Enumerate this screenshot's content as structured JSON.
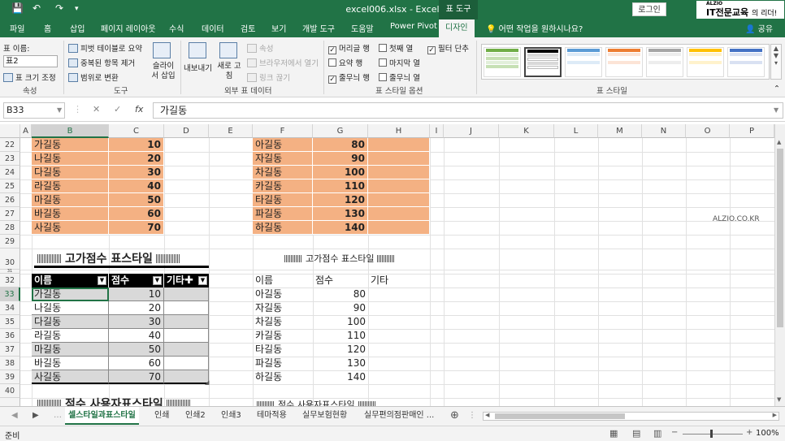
{
  "titlebar": {
    "title": "excel006.xlsx - Excel",
    "context_tab": "표 도구",
    "login": "로그인",
    "logo_top": "ALZIO",
    "logo_main": "IT전문교육",
    "logo_sub": "의 리더!"
  },
  "ribbon_tabs": [
    "파일",
    "홈",
    "삽입",
    "페이지 레이아웃",
    "수식",
    "데이터",
    "검토",
    "보기",
    "개발 도구",
    "도움말",
    "Power Pivot",
    "디자인"
  ],
  "tell_me": "어떤 작업을 원하시나요?",
  "share": "공유",
  "ribbon": {
    "props_label": "표 이름:",
    "table_name": "표2",
    "resize": "표 크기 조정",
    "props_group": "속성",
    "pivot": "피벗 테이블로 요약",
    "remove_dup": "중복된 항목 제거",
    "convert_range": "범위로 변환",
    "slicer": "슬라이서 삽입",
    "tools_group": "도구",
    "export": "내보내기",
    "refresh": "새로 고침",
    "properties": "속성",
    "open_browser": "브라우저에서 열기",
    "unlink": "링크 끊기",
    "external_group": "외부 표 데이터",
    "opt_header": "머리글 행",
    "opt_total": "요약 행",
    "opt_banded_rows": "줄무늬 행",
    "opt_first_col": "첫째 열",
    "opt_last_col": "마지막 열",
    "opt_banded_cols": "줄무늬 열",
    "opt_filter": "필터 단추",
    "options_group": "표 스타일 옵션",
    "styles_group": "표 스타일"
  },
  "formula_bar": {
    "name_box": "B33",
    "cancel": "✕",
    "enter": "✓",
    "fx": "fx",
    "formula": "가길동"
  },
  "columns": [
    "A",
    "B",
    "C",
    "D",
    "E",
    "F",
    "G",
    "H",
    "I",
    "J",
    "K",
    "L",
    "M",
    "N",
    "O",
    "P"
  ],
  "rows": [
    "22",
    "23",
    "24",
    "25",
    "26",
    "27",
    "28",
    "29",
    "30",
    "31",
    "32",
    "33",
    "34",
    "35",
    "36",
    "37",
    "38",
    "39",
    "40",
    "41"
  ],
  "orange_left": [
    {
      "name": "가길동",
      "score": "10"
    },
    {
      "name": "나길동",
      "score": "20"
    },
    {
      "name": "다길동",
      "score": "30"
    },
    {
      "name": "라길동",
      "score": "40"
    },
    {
      "name": "마길동",
      "score": "50"
    },
    {
      "name": "바길동",
      "score": "60"
    },
    {
      "name": "사길동",
      "score": "70"
    }
  ],
  "orange_right": [
    {
      "name": "아길동",
      "score": "80"
    },
    {
      "name": "자길동",
      "score": "90"
    },
    {
      "name": "차길동",
      "score": "100"
    },
    {
      "name": "카길동",
      "score": "110"
    },
    {
      "name": "타길동",
      "score": "120"
    },
    {
      "name": "파길동",
      "score": "130"
    },
    {
      "name": "하길동",
      "score": "140"
    }
  ],
  "section1_title": "고가점수 표스타일",
  "section2_title": "점수 사용자표스타일",
  "table_headers": [
    "이름",
    "점수",
    "기타"
  ],
  "table_left": [
    {
      "name": "가길동",
      "score": "10"
    },
    {
      "name": "나길동",
      "score": "20"
    },
    {
      "name": "다길동",
      "score": "30"
    },
    {
      "name": "라길동",
      "score": "40"
    },
    {
      "name": "마길동",
      "score": "50"
    },
    {
      "name": "바길동",
      "score": "60"
    },
    {
      "name": "사길동",
      "score": "70"
    }
  ],
  "table_right": [
    {
      "name": "아길동",
      "score": "80"
    },
    {
      "name": "자길동",
      "score": "90"
    },
    {
      "name": "차길동",
      "score": "100"
    },
    {
      "name": "카길동",
      "score": "110"
    },
    {
      "name": "타길동",
      "score": "120"
    },
    {
      "name": "파길동",
      "score": "130"
    },
    {
      "name": "하길동",
      "score": "140"
    }
  ],
  "watermark": "ALZIO.CO.KR",
  "sheet_tabs": [
    "셀스타일과표스타일",
    "인쇄",
    "인쇄2",
    "인쇄3",
    "테마적용",
    "실무보험현황",
    "실무편의점판매인 ..."
  ],
  "status": {
    "ready": "준비",
    "zoom": "100%"
  },
  "colors": {
    "excel_green": "#217346",
    "orange_fill": "#f4b183",
    "band_grey": "#d9d9d9"
  }
}
